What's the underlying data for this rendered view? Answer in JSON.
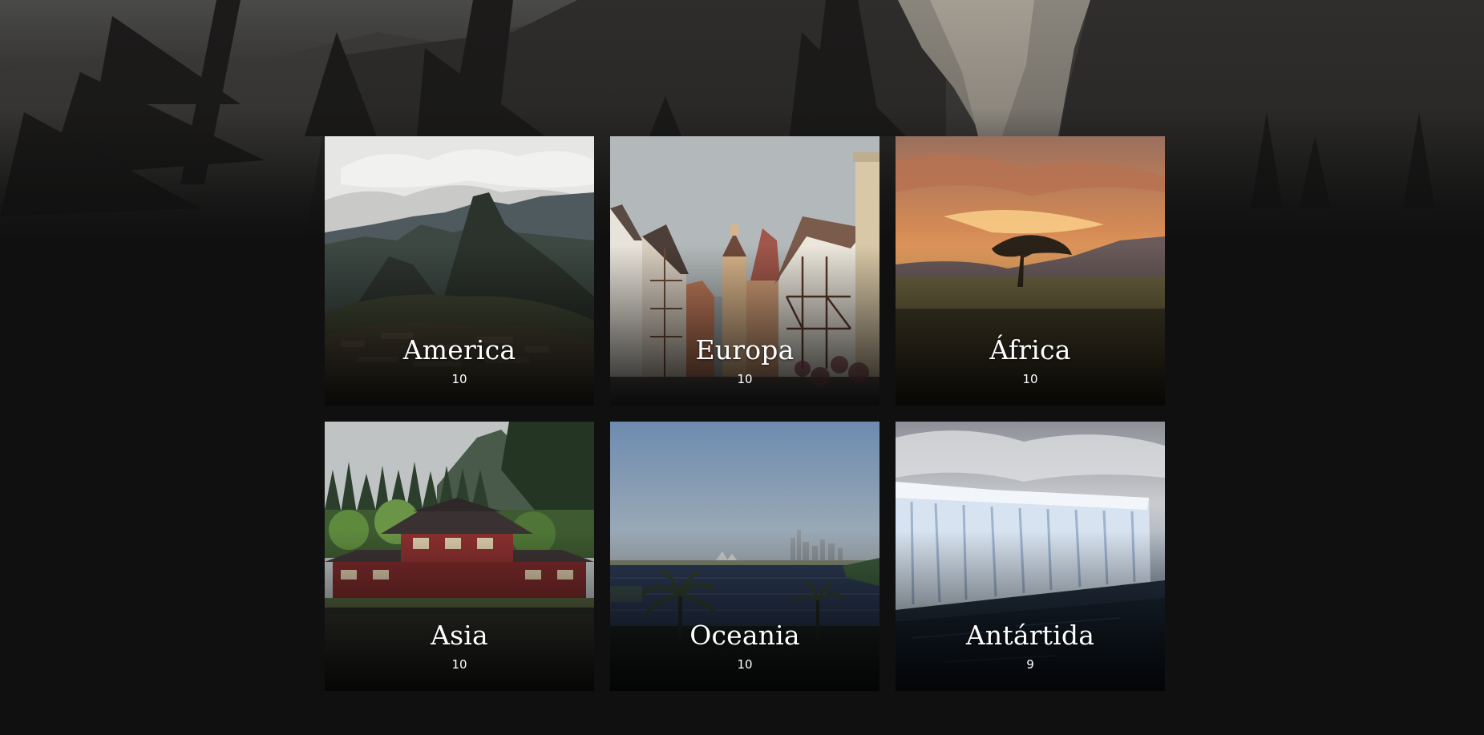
{
  "colors": {
    "page_background": "#101010",
    "text": "#ffffff"
  },
  "hero": {
    "scene": "forest-cliff-background"
  },
  "regions": [
    {
      "name": "America",
      "count": "10",
      "scene": "mountain-ruins"
    },
    {
      "name": "Europa",
      "count": "10",
      "scene": "old-town-street"
    },
    {
      "name": "África",
      "count": "10",
      "scene": "savanna-sunset"
    },
    {
      "name": "Asia",
      "count": "10",
      "scene": "temple-lake"
    },
    {
      "name": "Oceania",
      "count": "10",
      "scene": "harbour-skyline"
    },
    {
      "name": "Antártida",
      "count": "9",
      "scene": "ice-shelf"
    }
  ]
}
